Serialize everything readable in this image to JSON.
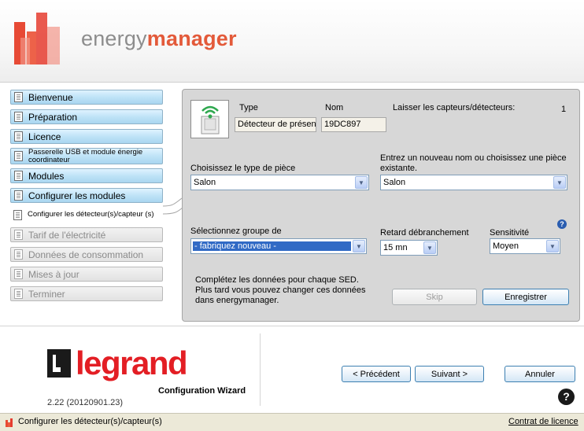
{
  "app": {
    "brand_light": "energy",
    "brand_bold": "manager",
    "legrand_label": "legrand",
    "wizard_label": "Configuration Wizard",
    "version": "2.22 (20120901.23)"
  },
  "nav": {
    "items": [
      {
        "label": "Bienvenue",
        "state": "done"
      },
      {
        "label": "Préparation",
        "state": "done"
      },
      {
        "label": "Licence",
        "state": "done"
      },
      {
        "label": "Passerelle USB et module énergie coordinateur",
        "state": "done"
      },
      {
        "label": "Modules",
        "state": "done"
      },
      {
        "label": "Configurer les modules",
        "state": "done"
      },
      {
        "label": "Configurer les détecteur(s)/capteur (s)",
        "state": "current"
      },
      {
        "label": "Tarif de l'électricité",
        "state": "disabled"
      },
      {
        "label": "Données de consommation",
        "state": "disabled"
      },
      {
        "label": "Mises à jour",
        "state": "disabled"
      },
      {
        "label": "Terminer",
        "state": "disabled"
      }
    ]
  },
  "panel": {
    "type_label": "Type",
    "name_label": "Nom",
    "remaining_label": "Laisser les capteurs/détecteurs:",
    "remaining_count": "1",
    "type_value": "Détecteur de présen",
    "name_value": "19DC897",
    "room_type_label": "Choisissez le type de pièce",
    "room_type_value": "Salon",
    "room_name_label": "Entrez un nouveau nom ou choisissez une pièce existante.",
    "room_name_value": "Salon",
    "group_label": "Sélectionnez groupe de",
    "group_value": "- fabriquez nouveau -",
    "delay_label": "Retard débranchement",
    "delay_value": "15 mn",
    "sensitivity_label": "Sensitivité",
    "sensitivity_value": "Moyen",
    "help_glyph": "?",
    "info_text_1": "Complétez les données pour chaque SED.",
    "info_text_2": "Plus tard vous pouvez changer ces données dans energymanager.",
    "skip_label": "Skip",
    "save_label": "Enregistrer"
  },
  "footer": {
    "prev_label": "< Précédent",
    "next_label": "Suivant >",
    "cancel_label": "Annuler",
    "help_glyph": "?"
  },
  "status": {
    "text": "Configurer les détecteur(s)/capteur(s)",
    "license_link": "Contrat de licence"
  },
  "colors": {
    "accent_red": "#e31e24",
    "brand_orange": "#e35a3a",
    "nav_blue": "#bfe3f7",
    "panel_gray": "#d7d7d7",
    "selection_blue": "#316ac5"
  }
}
